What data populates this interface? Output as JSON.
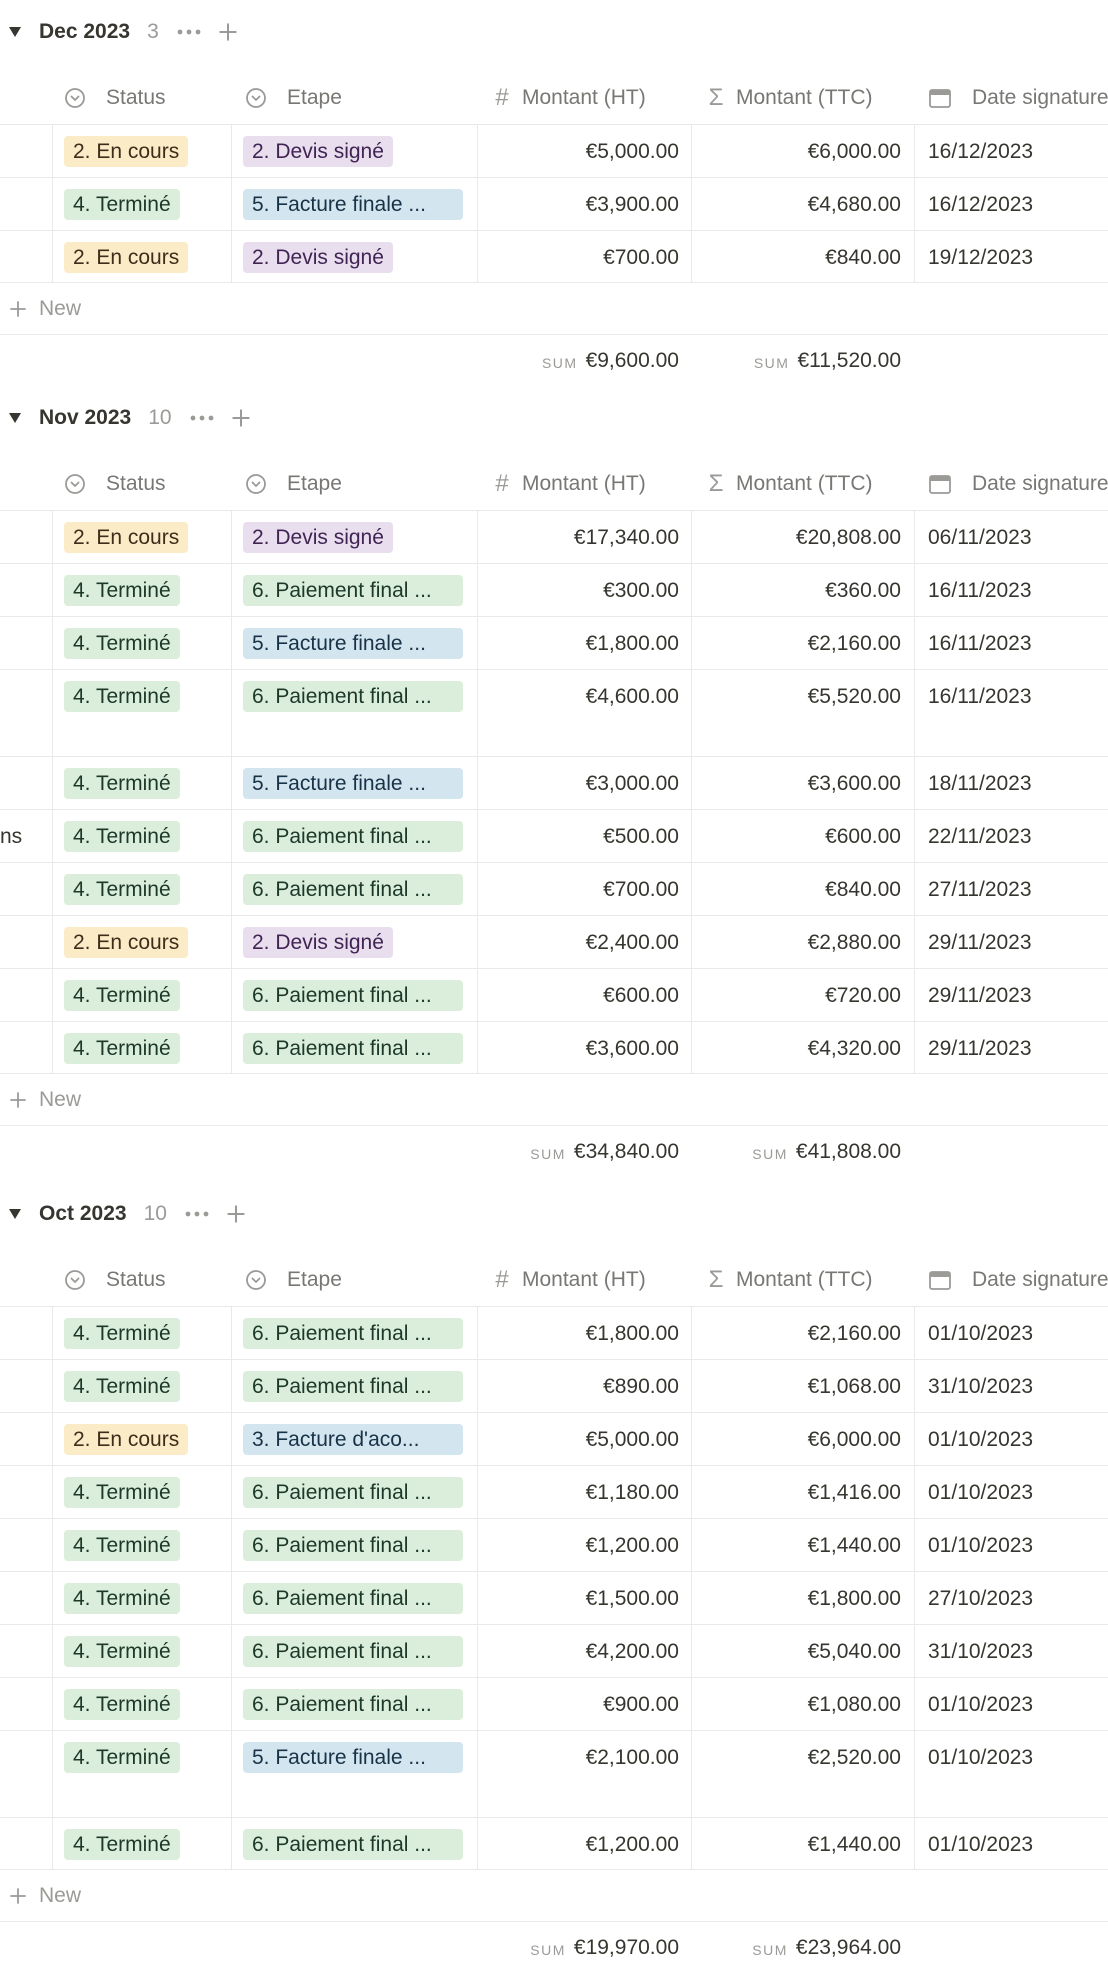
{
  "columns": {
    "status": "Status",
    "etape": "Etape",
    "montant_ht": "Montant (HT)",
    "montant_ttc": "Montant (TTC)",
    "date_signature": "Date signature"
  },
  "new_label": "New",
  "sum_label": "SUM",
  "tag_colors": {
    "En cours": {
      "bg": "#fbecc7",
      "fg": "#402c1b"
    },
    "Terminé": {
      "bg": "#dbeddb",
      "fg": "#1c3829"
    },
    "Devis": {
      "bg": "#e8deee",
      "fg": "#412454"
    },
    "Facture": {
      "bg": "#d3e5ef",
      "fg": "#183347"
    },
    "Paiement": {
      "bg": "#dbeddb",
      "fg": "#1c3829"
    }
  },
  "groups": [
    {
      "title": "Dec 2023",
      "count": "3",
      "rows": [
        {
          "name": "",
          "status": "2. En cours",
          "status_kind": "En cours",
          "etape": "2. Devis signé",
          "etape_kind": "Devis",
          "ht": "€5,000.00",
          "ttc": "€6,000.00",
          "date": "16/12/2023"
        },
        {
          "name": "",
          "status": "4. Terminé",
          "status_kind": "Terminé",
          "etape": "5. Facture finale ...",
          "etape_kind": "Facture",
          "ht": "€3,900.00",
          "ttc": "€4,680.00",
          "date": "16/12/2023"
        },
        {
          "name": "",
          "status": "2. En cours",
          "status_kind": "En cours",
          "etape": "2. Devis signé",
          "etape_kind": "Devis",
          "ht": "€700.00",
          "ttc": "€840.00",
          "date": "19/12/2023"
        }
      ],
      "sum_ht": "€9,600.00",
      "sum_ttc": "€11,520.00"
    },
    {
      "title": "Nov 2023",
      "count": "10",
      "rows": [
        {
          "name": "",
          "status": "2. En cours",
          "status_kind": "En cours",
          "etape": "2. Devis signé",
          "etape_kind": "Devis",
          "ht": "€17,340.00",
          "ttc": "€20,808.00",
          "date": "06/11/2023"
        },
        {
          "name": "",
          "status": "4. Terminé",
          "status_kind": "Terminé",
          "etape": "6. Paiement final ...",
          "etape_kind": "Paiement",
          "ht": "€300.00",
          "ttc": "€360.00",
          "date": "16/11/2023"
        },
        {
          "name": "",
          "status": "4. Terminé",
          "status_kind": "Terminé",
          "etape": "5. Facture finale ...",
          "etape_kind": "Facture",
          "ht": "€1,800.00",
          "ttc": "€2,160.00",
          "date": "16/11/2023"
        },
        {
          "name": "",
          "status": "4. Terminé",
          "status_kind": "Terminé",
          "etape": "6. Paiement final ...",
          "etape_kind": "Paiement",
          "ht": "€4,600.00",
          "ttc": "€5,520.00",
          "date": "16/11/2023",
          "tall": true
        },
        {
          "name": "",
          "status": "4. Terminé",
          "status_kind": "Terminé",
          "etape": "5. Facture finale ...",
          "etape_kind": "Facture",
          "ht": "€3,000.00",
          "ttc": "€3,600.00",
          "date": "18/11/2023"
        },
        {
          "name": "ns",
          "status": "4. Terminé",
          "status_kind": "Terminé",
          "etape": "6. Paiement final ...",
          "etape_kind": "Paiement",
          "ht": "€500.00",
          "ttc": "€600.00",
          "date": "22/11/2023"
        },
        {
          "name": "",
          "status": "4. Terminé",
          "status_kind": "Terminé",
          "etape": "6. Paiement final ...",
          "etape_kind": "Paiement",
          "ht": "€700.00",
          "ttc": "€840.00",
          "date": "27/11/2023"
        },
        {
          "name": "",
          "status": "2. En cours",
          "status_kind": "En cours",
          "etape": "2. Devis signé",
          "etape_kind": "Devis",
          "ht": "€2,400.00",
          "ttc": "€2,880.00",
          "date": "29/11/2023"
        },
        {
          "name": "",
          "status": "4. Terminé",
          "status_kind": "Terminé",
          "etape": "6. Paiement final ...",
          "etape_kind": "Paiement",
          "ht": "€600.00",
          "ttc": "€720.00",
          "date": "29/11/2023"
        },
        {
          "name": "",
          "status": "4. Terminé",
          "status_kind": "Terminé",
          "etape": "6. Paiement final ...",
          "etape_kind": "Paiement",
          "ht": "€3,600.00",
          "ttc": "€4,320.00",
          "date": "29/11/2023"
        }
      ],
      "sum_ht": "€34,840.00",
      "sum_ttc": "€41,808.00"
    },
    {
      "title": "Oct 2023",
      "count": "10",
      "rows": [
        {
          "name": "",
          "status": "4. Terminé",
          "status_kind": "Terminé",
          "etape": "6. Paiement final ...",
          "etape_kind": "Paiement",
          "ht": "€1,800.00",
          "ttc": "€2,160.00",
          "date": "01/10/2023"
        },
        {
          "name": "",
          "status": "4. Terminé",
          "status_kind": "Terminé",
          "etape": "6. Paiement final ...",
          "etape_kind": "Paiement",
          "ht": "€890.00",
          "ttc": "€1,068.00",
          "date": "31/10/2023"
        },
        {
          "name": "",
          "status": "2. En cours",
          "status_kind": "En cours",
          "etape": "3. Facture d'aco...",
          "etape_kind": "Facture",
          "ht": "€5,000.00",
          "ttc": "€6,000.00",
          "date": "01/10/2023"
        },
        {
          "name": "",
          "status": "4. Terminé",
          "status_kind": "Terminé",
          "etape": "6. Paiement final ...",
          "etape_kind": "Paiement",
          "ht": "€1,180.00",
          "ttc": "€1,416.00",
          "date": "01/10/2023"
        },
        {
          "name": "",
          "status": "4. Terminé",
          "status_kind": "Terminé",
          "etape": "6. Paiement final ...",
          "etape_kind": "Paiement",
          "ht": "€1,200.00",
          "ttc": "€1,440.00",
          "date": "01/10/2023"
        },
        {
          "name": "",
          "status": "4. Terminé",
          "status_kind": "Terminé",
          "etape": "6. Paiement final ...",
          "etape_kind": "Paiement",
          "ht": "€1,500.00",
          "ttc": "€1,800.00",
          "date": "27/10/2023"
        },
        {
          "name": "",
          "status": "4. Terminé",
          "status_kind": "Terminé",
          "etape": "6. Paiement final ...",
          "etape_kind": "Paiement",
          "ht": "€4,200.00",
          "ttc": "€5,040.00",
          "date": "31/10/2023"
        },
        {
          "name": "",
          "status": "4. Terminé",
          "status_kind": "Terminé",
          "etape": "6. Paiement final ...",
          "etape_kind": "Paiement",
          "ht": "€900.00",
          "ttc": "€1,080.00",
          "date": "01/10/2023"
        },
        {
          "name": "",
          "status": "4. Terminé",
          "status_kind": "Terminé",
          "etape": "5. Facture finale ...",
          "etape_kind": "Facture",
          "ht": "€2,100.00",
          "ttc": "€2,520.00",
          "date": "01/10/2023",
          "tall": true
        },
        {
          "name": "",
          "status": "4. Terminé",
          "status_kind": "Terminé",
          "etape": "6. Paiement final ...",
          "etape_kind": "Paiement",
          "ht": "€1,200.00",
          "ttc": "€1,440.00",
          "date": "01/10/2023"
        }
      ],
      "sum_ht": "€19,970.00",
      "sum_ttc": "€23,964.00"
    }
  ]
}
